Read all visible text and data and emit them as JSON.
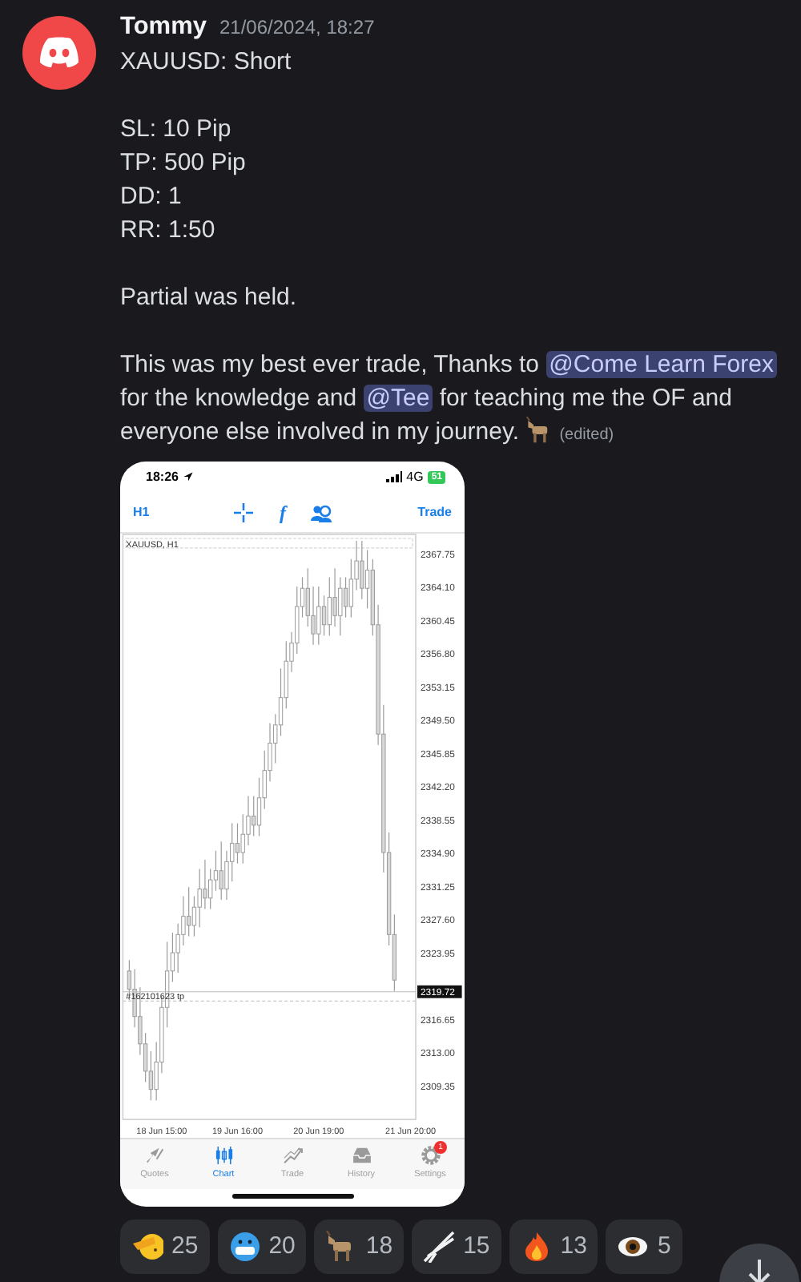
{
  "message": {
    "author": "Tommy",
    "timestamp": "21/06/2024, 18:27",
    "paragraphs": [
      {
        "kind": "lines",
        "lines": [
          "XAUUSD: Short"
        ]
      },
      {
        "kind": "lines",
        "lines": [
          "SL: 10 Pip",
          "TP: 500 Pip",
          "DD: 1",
          "RR: 1:50"
        ]
      },
      {
        "kind": "lines",
        "lines": [
          "Partial was held."
        ]
      },
      {
        "kind": "rich",
        "parts": [
          {
            "kind": "text",
            "text": "This was my best ever trade, Thanks to "
          },
          {
            "kind": "mention",
            "text": "@Come Learn Forex"
          },
          {
            "kind": "text",
            "text": " for the knowledge and "
          },
          {
            "kind": "mention",
            "text": "@Tee"
          },
          {
            "kind": "text",
            "text": " for teaching me the OF and everyone else involved in my journey. "
          },
          {
            "kind": "goat"
          },
          {
            "kind": "edited",
            "text": "(edited)"
          }
        ]
      }
    ]
  },
  "screenshot": {
    "status_time": "18:26",
    "network": "4G",
    "battery": "51",
    "toolbar": {
      "timeframe": "H1",
      "function_glyph": "f",
      "trade": "Trade"
    },
    "symbol_label": "XAUUSD, H1",
    "chart_data": {
      "type": "candlestick",
      "ylim": [
        2305.7,
        2370
      ],
      "categories": [
        null,
        null,
        null,
        null,
        null,
        null,
        "18 Jun 15:00",
        null,
        null,
        null,
        null,
        null,
        null,
        null,
        null,
        null,
        null,
        null,
        null,
        null,
        "19 Jun 16:00",
        null,
        null,
        null,
        null,
        null,
        null,
        null,
        null,
        null,
        null,
        null,
        null,
        null,
        null,
        "20 Jun 19:00",
        null,
        null,
        null,
        null,
        null,
        null,
        null,
        null,
        null,
        null,
        null,
        null,
        null,
        null,
        null,
        null,
        "21 Jun 20:00"
      ],
      "ohlc": [
        [
          2322,
          2323.2,
          2318.8,
          2320
        ],
        [
          2320,
          2322.2,
          2315.8,
          2317
        ],
        [
          2317,
          2320.2,
          2312.8,
          2314
        ],
        [
          2314,
          2315.2,
          2309.8,
          2311
        ],
        [
          2311,
          2313.2,
          2307.8,
          2309
        ],
        [
          2309,
          2314.2,
          2307.8,
          2312
        ],
        [
          2312,
          2319.2,
          2310.8,
          2318
        ],
        [
          2318,
          2325.2,
          2315.8,
          2322
        ],
        [
          2322,
          2326.2,
          2320.8,
          2324
        ],
        [
          2324,
          2327.2,
          2321.8,
          2326
        ],
        [
          2326,
          2330.2,
          2324.8,
          2328
        ],
        [
          2328,
          2331.2,
          2325.8,
          2327
        ],
        [
          2327,
          2330.2,
          2325.8,
          2329
        ],
        [
          2329,
          2333.2,
          2326.8,
          2331
        ],
        [
          2331,
          2334.2,
          2328.8,
          2330
        ],
        [
          2330,
          2333.2,
          2328.8,
          2332
        ],
        [
          2332,
          2335.2,
          2330.8,
          2333
        ],
        [
          2333,
          2336.2,
          2329.8,
          2331
        ],
        [
          2331,
          2335.2,
          2329.8,
          2334
        ],
        [
          2334,
          2338.2,
          2331.8,
          2336
        ],
        [
          2336,
          2338.2,
          2333.8,
          2335
        ],
        [
          2335,
          2339.2,
          2333.8,
          2337
        ],
        [
          2337,
          2341.2,
          2335.8,
          2339
        ],
        [
          2339,
          2341.2,
          2336.8,
          2338
        ],
        [
          2338,
          2343.2,
          2336.8,
          2341
        ],
        [
          2341,
          2346.2,
          2339.8,
          2344
        ],
        [
          2344,
          2349.2,
          2342.8,
          2347
        ],
        [
          2347,
          2350.2,
          2344.8,
          2349
        ],
        [
          2349,
          2355.2,
          2347.8,
          2352
        ],
        [
          2352,
          2358.2,
          2350.8,
          2356
        ],
        [
          2356,
          2359.2,
          2354.8,
          2358
        ],
        [
          2358,
          2364.2,
          2356.8,
          2362
        ],
        [
          2362,
          2365.2,
          2360.8,
          2364
        ],
        [
          2364,
          2366.2,
          2359.8,
          2361
        ],
        [
          2361,
          2364.2,
          2357.8,
          2359
        ],
        [
          2359,
          2364.2,
          2357.8,
          2362
        ],
        [
          2362,
          2363.2,
          2358.8,
          2360
        ],
        [
          2360,
          2365.2,
          2358.8,
          2363
        ],
        [
          2363,
          2366.2,
          2359.8,
          2361
        ],
        [
          2361,
          2365.2,
          2358.8,
          2364
        ],
        [
          2364,
          2365.2,
          2360.8,
          2362
        ],
        [
          2362,
          2367.2,
          2360.8,
          2365
        ],
        [
          2365,
          2369.2,
          2363.8,
          2367
        ],
        [
          2367,
          2369.2,
          2362.8,
          2364
        ],
        [
          2364,
          2368.2,
          2361.8,
          2366
        ],
        [
          2366,
          2367.2,
          2358.8,
          2360
        ],
        [
          2360,
          2362.2,
          2346.8,
          2348
        ],
        [
          2348,
          2351.2,
          2332.8,
          2335
        ],
        [
          2335,
          2337.2,
          2324.8,
          2326
        ],
        [
          2326,
          2328.2,
          2319.8,
          2321
        ],
        null,
        null,
        null
      ],
      "yticks": [
        {
          "value": 2367.75,
          "label": "2367.75"
        },
        {
          "value": 2364.1,
          "label": "2364.10"
        },
        {
          "value": 2360.45,
          "label": "2360.45"
        },
        {
          "value": 2356.8,
          "label": "2356.80"
        },
        {
          "value": 2353.15,
          "label": "2353.15"
        },
        {
          "value": 2349.5,
          "label": "2349.50"
        },
        {
          "value": 2345.85,
          "label": "2345.85"
        },
        {
          "value": 2342.2,
          "label": "2342.20"
        },
        {
          "value": 2338.55,
          "label": "2338.55"
        },
        {
          "value": 2334.9,
          "label": "2334.90"
        },
        {
          "value": 2331.25,
          "label": "2331.25"
        },
        {
          "value": 2327.6,
          "label": "2327.60"
        },
        {
          "value": 2323.95,
          "label": "2323.95"
        },
        {
          "value": 2316.65,
          "label": "2316.65"
        },
        {
          "value": 2313,
          "label": "2313.00"
        },
        {
          "value": 2309.35,
          "label": "2309.35"
        }
      ],
      "ref_lines": [
        {
          "axis": "y",
          "value": 2319.72,
          "label": "2319.72"
        },
        {
          "axis": "y",
          "value": 2318.7,
          "label": "#162101623 tp"
        }
      ]
    },
    "tabs": [
      {
        "kind": "quotes",
        "label": "Quotes",
        "selected": false
      },
      {
        "kind": "chart",
        "label": "Chart",
        "selected": true
      },
      {
        "kind": "trade",
        "label": "Trade",
        "selected": false
      },
      {
        "kind": "history",
        "label": "History",
        "selected": false
      },
      {
        "kind": "settings",
        "label": "Settings",
        "selected": false,
        "badge": "1"
      }
    ]
  },
  "reactions": [
    {
      "kind": "salute",
      "count": "25"
    },
    {
      "kind": "cold",
      "count": "20"
    },
    {
      "kind": "goat",
      "count": "18"
    },
    {
      "kind": "rifle",
      "count": "15"
    },
    {
      "kind": "fire",
      "count": "13"
    },
    {
      "kind": "eye",
      "count": "5"
    }
  ]
}
